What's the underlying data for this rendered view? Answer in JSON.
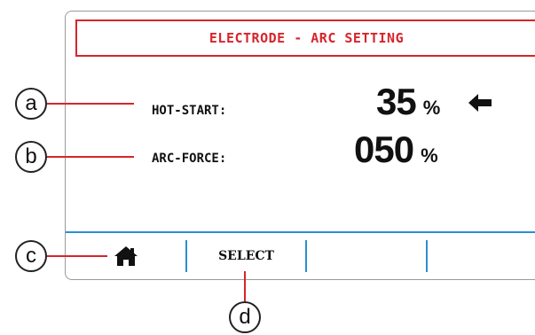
{
  "header": {
    "title": "ELECTRODE - ARC SETTING"
  },
  "params": [
    {
      "label": "HOT-START:",
      "value": "35",
      "unit": "%"
    },
    {
      "label": "ARC-FORCE:",
      "value": "050",
      "unit": "%"
    }
  ],
  "selected_param_indicator": "arrow-left-icon",
  "softkeys": [
    {
      "icon": "home-icon",
      "label": ""
    },
    {
      "label": "SELECT"
    },
    {
      "label": ""
    },
    {
      "label": ""
    }
  ],
  "callouts": {
    "a": "a",
    "b": "b",
    "c": "c",
    "d": "d"
  },
  "colors": {
    "accent_red": "#d6252b",
    "divider_blue": "#2a8fd0",
    "text": "#111111"
  }
}
